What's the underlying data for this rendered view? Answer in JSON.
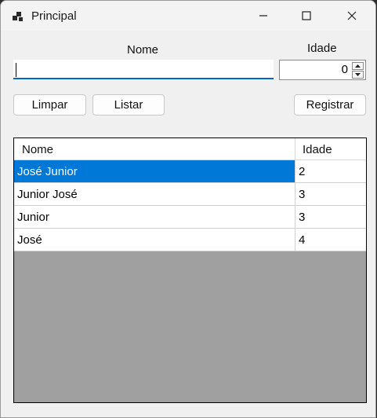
{
  "window": {
    "title": "Principal"
  },
  "form": {
    "name_label": "Nome",
    "age_label": "Idade",
    "name_value": "",
    "age_value": "0"
  },
  "buttons": {
    "clear": "Limpar",
    "list": "Listar",
    "register": "Registrar"
  },
  "grid": {
    "columns": [
      "Nome",
      "Idade"
    ],
    "rows": [
      {
        "nome": "José Junior",
        "idade": "2",
        "selected": true
      },
      {
        "nome": "Junior José",
        "idade": "3",
        "selected": false
      },
      {
        "nome": "Junior",
        "idade": "3",
        "selected": false
      },
      {
        "nome": "José",
        "idade": "4",
        "selected": false
      }
    ]
  },
  "colors": {
    "accent": "#0078d7",
    "grid_background": "#a0a0a0",
    "window_background": "#f0f0f0"
  }
}
